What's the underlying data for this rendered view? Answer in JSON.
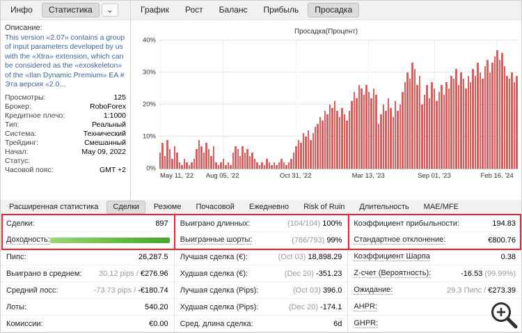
{
  "header": {
    "left_tabs": [
      {
        "label": "Инфо",
        "active": false
      },
      {
        "label": "Статистика",
        "active": true
      }
    ],
    "dropdown_icon": "chevron-down",
    "dropdown_glyph": "⌄",
    "chart_tabs": [
      {
        "label": "График",
        "active": false
      },
      {
        "label": "Рост",
        "active": false
      },
      {
        "label": "Баланс",
        "active": false
      },
      {
        "label": "Прибыль",
        "active": false
      },
      {
        "label": "Просадка",
        "active": true
      }
    ]
  },
  "description": {
    "label": "Описание:",
    "text": "This version «2.07» contains a group of input parameters developed by us with the «Xtra» extension, which can be considered as the «exoskeleton» of the «Ilan Dynamic Premium» EA # Эта версия «2.0..."
  },
  "info_rows": [
    {
      "label": "Просмотры:",
      "value": "125"
    },
    {
      "label": "Брокер:",
      "value": "RoboForex"
    },
    {
      "label": "Кредитное плечо:",
      "value": "1:1000"
    },
    {
      "label": "Тип:",
      "value": "Реальный"
    },
    {
      "label": "Система:",
      "value": "Технический"
    },
    {
      "label": "Трейдинг:",
      "value": "Смешанный"
    },
    {
      "label": "Начал:",
      "value": "May 09, 2022"
    },
    {
      "label": "Статус:",
      "value": ""
    },
    {
      "label": "Часовой пояс:",
      "value": "GMT +2"
    }
  ],
  "chart_data": {
    "type": "bar",
    "title": "Просадка(Процент)",
    "xlabel": "",
    "ylabel": "",
    "ylim": [
      0,
      40
    ],
    "grid": "dotted",
    "bar_color": "#dd5c5c",
    "ytick_labels": [
      "0%",
      "10%",
      "20%",
      "30%",
      "40%"
    ],
    "xtick_labels": [
      "May 11, '22",
      "Aug 05, '22",
      "Oct 31, '22",
      "Mar 13, '23",
      "Sep 01, '23",
      "Feb 16, '24"
    ],
    "xtick_pos": [
      0.002,
      0.176,
      0.38,
      0.583,
      0.767,
      0.942
    ],
    "values": [
      5,
      8,
      4,
      9,
      6,
      3,
      7,
      5,
      2,
      1,
      3,
      2,
      1,
      2,
      3,
      6,
      9,
      7,
      5,
      8,
      6,
      4,
      7,
      2,
      1,
      2,
      3,
      1,
      2,
      1,
      5,
      7,
      6,
      4,
      7,
      5,
      6,
      4,
      5,
      3,
      2,
      1,
      2,
      1,
      3,
      2,
      1,
      2,
      1,
      2,
      3,
      2,
      1,
      2,
      3,
      5,
      7,
      9,
      8,
      11,
      10,
      12,
      9,
      11,
      13,
      14,
      16,
      15,
      18,
      17,
      20,
      19,
      21,
      18,
      16,
      19,
      17,
      15,
      18,
      21,
      24,
      22,
      26,
      25,
      23,
      26,
      24,
      22,
      25,
      23,
      14,
      17,
      20,
      18,
      22,
      19,
      16,
      21,
      18,
      20,
      24,
      27,
      30,
      28,
      33,
      31,
      26,
      29,
      20,
      23,
      26,
      22,
      27,
      25,
      21,
      24,
      26,
      23,
      27,
      25,
      29,
      28,
      31,
      26,
      30,
      28,
      25,
      29,
      27,
      31,
      29,
      33,
      30,
      28,
      32,
      34,
      30,
      33,
      35,
      37,
      34,
      36,
      32,
      29,
      28,
      30,
      27,
      29
    ]
  },
  "bottom_tabs": [
    {
      "label": "Расширенная статистика",
      "active": false
    },
    {
      "label": "Сделки",
      "active": true
    },
    {
      "label": "Резюме",
      "active": false
    },
    {
      "label": "Почасовой",
      "active": false
    },
    {
      "label": "Ежедневно",
      "active": false
    },
    {
      "label": "Risk of Ruin",
      "active": false
    },
    {
      "label": "Длительность",
      "active": false
    },
    {
      "label": "MAE/MFE",
      "active": false
    }
  ],
  "stats_columns": [
    [
      {
        "label": "Сделки:",
        "value": "897"
      },
      {
        "label": "Доходность:",
        "tip": true,
        "bar": true
      },
      {
        "label": "Пипс:",
        "value": "26,287.5"
      },
      {
        "label": "Выиграно в среднем:",
        "pre": "30.12 pips /",
        "value": "€276.96"
      },
      {
        "label": "Средний лосс:",
        "pre": "-73.73 pips /",
        "value": "-€180.74"
      },
      {
        "label": "Лоты:",
        "value": "540.20"
      },
      {
        "label": "Комиссии:",
        "value": "€0.00"
      }
    ],
    [
      {
        "label": "Выиграно длинных:",
        "pre": "(104/104)",
        "value": "100%"
      },
      {
        "label": "Выигранные шорты:",
        "tip": true,
        "pre": "(786/793)",
        "value": "99%"
      },
      {
        "label": "Лучшая сделка (€):",
        "pre": "(Oct 03)",
        "value": "18,898.29"
      },
      {
        "label": "Худшая сделка (€):",
        "pre": "(Dec 20)",
        "value": "-351.23"
      },
      {
        "label": "Лучшая сделка (Pips):",
        "pre": "(Oct 03)",
        "value": "396.0"
      },
      {
        "label": "Худшая сделка (Pips):",
        "pre": "(Dec 20)",
        "value": "-174.1"
      },
      {
        "label": "Сред. длина сделка:",
        "value": "6d"
      }
    ],
    [
      {
        "label": "Коэффициент прибыльности:",
        "value": "194.83"
      },
      {
        "label": "Стандартное отклонение:",
        "tip": true,
        "value": "€800.76"
      },
      {
        "label": "Коэффициент Шарпа",
        "tip": true,
        "value": "0.38"
      },
      {
        "label": "Z-счет (Вероятность):",
        "tip": true,
        "value": "-16.53",
        "post": "(99.99%)"
      },
      {
        "label": "Ожидание:",
        "tip": true,
        "pre": "29.3 Пипс /",
        "value": "€273.39"
      },
      {
        "label": "AHPR:",
        "tip": true,
        "value": ""
      },
      {
        "label": "GHPR:",
        "tip": true,
        "value": ""
      }
    ]
  ],
  "colors": {
    "annotation_red": "#e8232b",
    "bar_red": "#dd5c5c",
    "profit_green_start": "#9ad877",
    "profit_green_end": "#4aa52e",
    "link_blue": "#3c64a4",
    "active_tab_bg": "#dcdcdc"
  }
}
